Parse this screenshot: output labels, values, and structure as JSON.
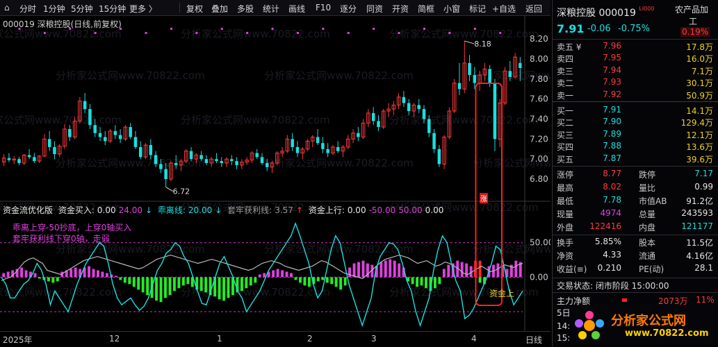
{
  "toolbar": {
    "left": [
      "分时",
      "1分钟",
      "5分钟",
      "15分钟",
      "更多 〉"
    ],
    "right": [
      "复权",
      "叠加",
      "多股",
      "统计",
      "画线",
      "F10",
      "逐分",
      "同资",
      "开资",
      "简框",
      "小窗",
      "标记",
      "+自选",
      "返回"
    ]
  },
  "chart_title": "000019 深粮控股(日线,前复权)",
  "indicator": {
    "name": "资金流优化版",
    "buy_label": "资金买入:",
    "buy_v1": "0.00",
    "buy_v2": "24.00",
    "leave_label": "乖离线:",
    "leave_v": "20.00",
    "trap_label": "套牢获利线:",
    "trap_v": "3.57",
    "rise_label": "资金上行:",
    "rise_v1": "0.00",
    "rise_v2": "-50.00",
    "rise_v3": "50.00",
    "rise_v4": "0.00",
    "note1": "乖离上穿-50抄底，上穿0轴买入",
    "note2": "套牢获利线下穿0轴，走弱",
    "event_label": "资金上行",
    "event_char": "涨"
  },
  "price_axis": [
    "8.20",
    "8.00",
    "7.80",
    "7.60",
    "7.40",
    "7.20",
    "7.00",
    "6.80"
  ],
  "ind_axis": [
    "50.00",
    "0.00"
  ],
  "high_mark": "8.18",
  "low_mark": "6.72",
  "x_axis": [
    "2025年",
    "12",
    "1",
    "2",
    "3",
    "4",
    "日线"
  ],
  "watermark": "分析家公式网www.70822.com",
  "chart_data": {
    "type": "candlestick",
    "ylim": [
      6.62,
      8.34
    ],
    "ohlc": [
      [
        6.97,
        7.05,
        6.93,
        7.01
      ],
      [
        7.01,
        7.06,
        6.97,
        6.99
      ],
      [
        6.99,
        7.03,
        6.95,
        7.0
      ],
      [
        7.0,
        7.02,
        6.94,
        6.96
      ],
      [
        6.96,
        7.05,
        6.94,
        7.04
      ],
      [
        7.04,
        7.1,
        7.0,
        7.02
      ],
      [
        7.02,
        7.06,
        6.96,
        6.98
      ],
      [
        6.98,
        7.04,
        6.96,
        7.03
      ],
      [
        7.03,
        7.25,
        7.02,
        7.2
      ],
      [
        7.2,
        7.28,
        7.08,
        7.12
      ],
      [
        7.12,
        7.18,
        7.0,
        7.05
      ],
      [
        7.05,
        7.15,
        7.02,
        7.13
      ],
      [
        7.13,
        7.35,
        7.1,
        7.3
      ],
      [
        7.3,
        7.34,
        7.18,
        7.22
      ],
      [
        7.22,
        7.42,
        7.2,
        7.38
      ],
      [
        7.38,
        7.62,
        7.36,
        7.58
      ],
      [
        7.58,
        7.66,
        7.46,
        7.5
      ],
      [
        7.5,
        7.55,
        7.3,
        7.34
      ],
      [
        7.34,
        7.4,
        7.22,
        7.26
      ],
      [
        7.26,
        7.32,
        7.18,
        7.22
      ],
      [
        7.22,
        7.28,
        7.14,
        7.18
      ],
      [
        7.18,
        7.3,
        7.16,
        7.28
      ],
      [
        7.28,
        7.34,
        7.2,
        7.24
      ],
      [
        7.24,
        7.3,
        7.16,
        7.2
      ],
      [
        7.2,
        7.34,
        7.18,
        7.32
      ],
      [
        7.32,
        7.36,
        7.2,
        7.22
      ],
      [
        7.22,
        7.28,
        7.1,
        7.12
      ],
      [
        7.12,
        7.18,
        7.0,
        7.02
      ],
      [
        7.02,
        7.16,
        7.0,
        7.14
      ],
      [
        7.14,
        7.2,
        7.0,
        7.04
      ],
      [
        7.04,
        7.08,
        6.92,
        6.95
      ],
      [
        6.95,
        7.0,
        6.86,
        6.9
      ],
      [
        6.9,
        6.96,
        6.72,
        6.8
      ],
      [
        6.8,
        6.98,
        6.78,
        6.96
      ],
      [
        6.96,
        7.04,
        6.9,
        6.94
      ],
      [
        6.94,
        7.0,
        6.88,
        6.98
      ],
      [
        6.98,
        7.1,
        6.96,
        7.08
      ],
      [
        7.08,
        7.12,
        6.98,
        7.0
      ],
      [
        7.0,
        7.06,
        6.96,
        7.04
      ],
      [
        7.04,
        7.08,
        6.98,
        7.0
      ],
      [
        7.0,
        7.04,
        6.94,
        6.96
      ],
      [
        6.96,
        7.02,
        6.92,
        7.0
      ],
      [
        7.0,
        7.06,
        6.96,
        6.98
      ],
      [
        6.98,
        7.02,
        6.92,
        6.96
      ],
      [
        6.96,
        7.02,
        6.92,
        7.0
      ],
      [
        7.0,
        7.04,
        6.94,
        6.98
      ],
      [
        6.98,
        7.02,
        6.9,
        6.94
      ],
      [
        6.94,
        7.0,
        6.9,
        6.97
      ],
      [
        6.97,
        7.02,
        6.94,
        6.99
      ],
      [
        6.99,
        7.08,
        6.96,
        7.06
      ],
      [
        7.06,
        7.1,
        7.0,
        7.02
      ],
      [
        7.02,
        7.06,
        6.94,
        6.96
      ],
      [
        6.96,
        7.0,
        6.88,
        6.92
      ],
      [
        6.92,
        6.98,
        6.86,
        6.96
      ],
      [
        6.96,
        7.08,
        6.94,
        7.06
      ],
      [
        7.06,
        7.12,
        7.02,
        7.08
      ],
      [
        7.08,
        7.24,
        7.06,
        7.2
      ],
      [
        7.2,
        7.26,
        7.08,
        7.12
      ],
      [
        7.12,
        7.18,
        7.02,
        7.06
      ],
      [
        7.06,
        7.12,
        7.0,
        7.1
      ],
      [
        7.1,
        7.2,
        7.08,
        7.18
      ],
      [
        7.18,
        7.24,
        7.12,
        7.22
      ],
      [
        7.22,
        7.3,
        7.14,
        7.16
      ],
      [
        7.16,
        7.22,
        7.06,
        7.1
      ],
      [
        7.1,
        7.16,
        7.02,
        7.06
      ],
      [
        7.06,
        7.14,
        7.04,
        7.12
      ],
      [
        7.12,
        7.18,
        7.06,
        7.08
      ],
      [
        7.08,
        7.14,
        7.02,
        7.12
      ],
      [
        7.12,
        7.24,
        7.1,
        7.2
      ],
      [
        7.2,
        7.3,
        7.16,
        7.26
      ],
      [
        7.26,
        7.32,
        7.18,
        7.22
      ],
      [
        7.22,
        7.4,
        7.2,
        7.36
      ],
      [
        7.36,
        7.5,
        7.32,
        7.46
      ],
      [
        7.46,
        7.52,
        7.34,
        7.38
      ],
      [
        7.38,
        7.44,
        7.28,
        7.32
      ],
      [
        7.32,
        7.5,
        7.3,
        7.48
      ],
      [
        7.48,
        7.56,
        7.42,
        7.5
      ],
      [
        7.5,
        7.58,
        7.44,
        7.54
      ],
      [
        7.54,
        7.66,
        7.5,
        7.62
      ],
      [
        7.62,
        7.68,
        7.52,
        7.56
      ],
      [
        7.56,
        7.6,
        7.44,
        7.48
      ],
      [
        7.48,
        7.56,
        7.42,
        7.54
      ],
      [
        7.54,
        7.6,
        7.46,
        7.5
      ],
      [
        7.5,
        7.54,
        7.36,
        7.4
      ],
      [
        7.4,
        7.44,
        7.22,
        7.26
      ],
      [
        7.26,
        7.3,
        7.06,
        7.1
      ],
      [
        7.1,
        7.14,
        6.92,
        6.95
      ],
      [
        6.95,
        7.24,
        6.9,
        7.22
      ],
      [
        7.22,
        7.52,
        7.2,
        7.48
      ],
      [
        7.48,
        7.8,
        7.46,
        7.76
      ],
      [
        7.76,
        7.96,
        7.64,
        7.7
      ],
      [
        7.7,
        8.18,
        7.66,
        7.96
      ],
      [
        7.96,
        8.04,
        7.78,
        7.84
      ],
      [
        7.84,
        7.92,
        7.7,
        7.76
      ],
      [
        7.76,
        7.88,
        7.68,
        7.84
      ],
      [
        7.84,
        7.96,
        7.78,
        7.9
      ],
      [
        7.9,
        7.94,
        7.72,
        7.76
      ],
      [
        7.76,
        7.8,
        7.08,
        7.2
      ],
      [
        7.2,
        7.6,
        7.12,
        7.56
      ],
      [
        7.56,
        7.92,
        7.54,
        7.88
      ],
      [
        7.88,
        7.98,
        7.78,
        7.82
      ],
      [
        7.82,
        8.06,
        7.8,
        8.02
      ],
      [
        7.96,
        8.02,
        7.78,
        7.91
      ]
    ],
    "indicator": {
      "ylim": [
        -75,
        100
      ],
      "levels": [
        50,
        0,
        -50
      ],
      "bars": [
        6,
        8,
        10,
        12,
        14,
        10,
        8,
        6,
        -2,
        -4,
        -6,
        -8,
        -6,
        8,
        10,
        12,
        14,
        12,
        14,
        16,
        12,
        10,
        8,
        6,
        4,
        2,
        -4,
        -8,
        -10,
        -14,
        -18,
        -22,
        -26,
        -30,
        -34,
        -36,
        -30,
        -26,
        -20,
        -16,
        -12,
        -10,
        -14,
        -18,
        -20,
        -22,
        -26,
        -28,
        -32,
        -34,
        -30,
        -26,
        -22,
        -20,
        -16,
        -12,
        -8,
        4,
        6,
        8,
        10,
        12,
        10,
        8,
        6,
        -4,
        -8,
        -12,
        -14,
        -10,
        -6,
        -4,
        -8,
        -10,
        -14,
        -18,
        -12,
        14,
        20,
        22,
        24,
        20,
        18,
        16,
        22,
        24,
        26,
        24,
        20,
        14,
        -6,
        -10,
        -14,
        -12,
        -16,
        -20,
        -16,
        -10,
        12,
        18,
        20,
        24,
        22,
        20,
        16,
        14,
        -8,
        -10,
        16,
        18,
        20,
        16,
        12,
        18,
        24,
        22
      ],
      "white": [
        -5,
        -2,
        0,
        6,
        14,
        22,
        26,
        28,
        24,
        20,
        10,
        8,
        6,
        4,
        8,
        12,
        16,
        20,
        24,
        26,
        28,
        30,
        28,
        26,
        24,
        22,
        20,
        18,
        16,
        14,
        12,
        14,
        18,
        22,
        26,
        28,
        30,
        32,
        30,
        28,
        26,
        24,
        22,
        20,
        22,
        24,
        26,
        24,
        22,
        20,
        18,
        16,
        14,
        12,
        10,
        12,
        16,
        20,
        22,
        24,
        22,
        20,
        16,
        14,
        12,
        10,
        12,
        14,
        16,
        20,
        24,
        22,
        18,
        14,
        10,
        6,
        4,
        2,
        0,
        -2,
        4,
        10,
        16,
        22,
        26,
        28,
        30,
        32,
        30,
        28,
        24,
        20,
        22,
        24,
        20,
        16,
        18,
        22,
        20,
        16,
        12,
        6,
        4,
        8,
        12,
        16,
        12,
        8,
        10,
        14,
        18,
        16,
        14,
        18,
        20
      ],
      "cyan": [
        0,
        -10,
        -30,
        -30,
        -20,
        -10,
        -5,
        5,
        20,
        10,
        -10,
        -40,
        -20,
        -30,
        -40,
        -50,
        -30,
        -10,
        5,
        20,
        30,
        40,
        50,
        45,
        20,
        -10,
        -30,
        -40,
        -35,
        -30,
        -40,
        -48,
        -42,
        -30,
        -10,
        10,
        20,
        35,
        40,
        50,
        45,
        30,
        20,
        0,
        -20,
        -38,
        -40,
        -20,
        0,
        20,
        30,
        15,
        0,
        -20,
        -30,
        -50,
        -40,
        -30,
        -20,
        -5,
        10,
        20,
        30,
        40,
        50,
        60,
        78,
        60,
        40,
        20,
        -10,
        -30,
        -20,
        10,
        40,
        60,
        50,
        20,
        -10,
        -30,
        -50,
        -70,
        -50,
        -30,
        10,
        30,
        40,
        50,
        48,
        40,
        20,
        -5,
        -20,
        -50,
        -70,
        -50,
        -30,
        10,
        40,
        60,
        50,
        20,
        -5,
        -20,
        -60,
        -55,
        -45,
        -30,
        -15,
        0,
        20,
        45,
        40,
        10,
        -20,
        -40,
        -30,
        -20
      ]
    }
  },
  "panel": {
    "stock_name": "深粮控股",
    "stock_code": "000019",
    "tag": "LI000",
    "sector_line1": "农产品加",
    "sector_line2": "工",
    "sector_pct": "0.19%",
    "price": "7.91",
    "change": "-0.06",
    "change_pct": "-0.75%",
    "currency": "¥",
    "asks": [
      {
        "label": "卖五",
        "price": "7.96",
        "vol": "17.8万"
      },
      {
        "label": "卖四",
        "price": "7.95",
        "vol": "16.0万"
      },
      {
        "label": "卖三",
        "price": "7.94",
        "vol": "7.1万"
      },
      {
        "label": "卖二",
        "price": "7.93",
        "vol": "30.1万"
      },
      {
        "label": "卖一",
        "price": "7.92",
        "vol": "50.9万"
      }
    ],
    "bids": [
      {
        "label": "买一",
        "price": "7.91",
        "vol": "14.1万"
      },
      {
        "label": "买二",
        "price": "7.90",
        "vol": "129.4万"
      },
      {
        "label": "买三",
        "price": "7.89",
        "vol": "12.1万"
      },
      {
        "label": "买四",
        "price": "7.88",
        "vol": "13.6万"
      },
      {
        "label": "买五",
        "price": "7.87",
        "vol": "39.6万"
      }
    ],
    "stats": [
      {
        "k1": "涨停",
        "v1": "8.77",
        "k2": "跌停",
        "v2": "7.17"
      },
      {
        "k1": "最高",
        "v1": "8.02",
        "k2": "量比",
        "v2": "0.99"
      },
      {
        "k1": "最低",
        "v1": "7.78",
        "k2": "市值AB",
        "v2": "91.2亿"
      },
      {
        "k1": "现量",
        "v1": "4974",
        "k2": "总量",
        "v2": "243593"
      },
      {
        "k1": "外盘",
        "v1": "122416",
        "k2": "内盘",
        "v2": "121177"
      }
    ],
    "stats2": [
      {
        "k1": "换手",
        "v1": "5.85%",
        "k2": "股本",
        "v2": "11.5亿"
      },
      {
        "k1": "净资",
        "v1": "4.33",
        "k2": "流通",
        "v2": "4.16亿"
      },
      {
        "k1": "收益(≡)",
        "v1": "0.210",
        "k2": "PE(动)",
        "v2": "28.1"
      }
    ],
    "trade_status": "交易状态: 闭市阶段 15:00:00",
    "main_label": "主力净额",
    "main_value": "2073万",
    "main_pct": "11%",
    "day_label": "5日",
    "time_fragment1": "14:5",
    "time_fragment2": "15:0",
    "logo_text": "分析家公式网",
    "logo_url": "www.70822.com"
  },
  "colors": {
    "up": "#ff3b3b",
    "down": "#19e0e0",
    "magenta": "#e040e0",
    "green": "#22ee22",
    "highlight": "#ff2020",
    "logo": "#ff7a00"
  }
}
